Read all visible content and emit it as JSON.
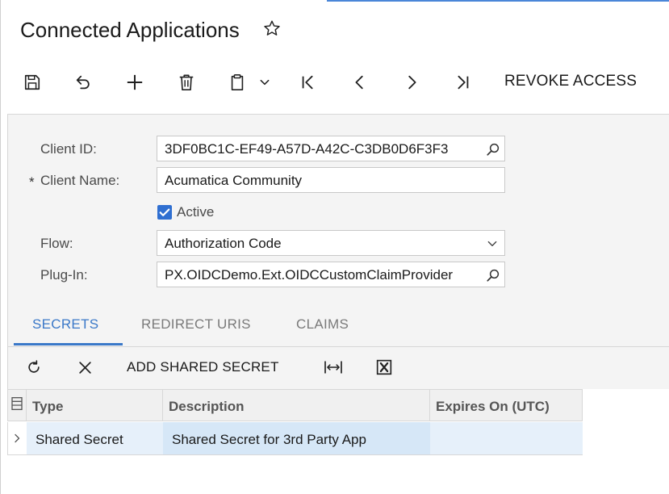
{
  "page": {
    "title": "Connected Applications"
  },
  "toolbar": {
    "buttons": [
      "save-icon",
      "undo-icon",
      "add-icon",
      "delete-icon",
      "clipboard-icon",
      "chevron-down-icon",
      "first-record-icon",
      "previous-record-icon",
      "next-record-icon",
      "last-record-icon"
    ],
    "revoke_label": "REVOKE ACCESS"
  },
  "form": {
    "client_id_label": "Client ID:",
    "client_id_value": "3DF0BC1C-EF49-A57D-A42C-C3DB0D6F3F3",
    "required_marker": "*",
    "client_name_label": "Client Name:",
    "client_name_value": "Acumatica Community",
    "active_label": "Active",
    "active_checked": true,
    "flow_label": "Flow:",
    "flow_value": "Authorization Code",
    "plugin_label": "Plug-In:",
    "plugin_value": "PX.OIDCDemo.Ext.OIDCCustomClaimProvider"
  },
  "tabs": [
    {
      "label": "SECRETS",
      "active": true
    },
    {
      "label": "REDIRECT URIS",
      "active": false
    },
    {
      "label": "CLAIMS",
      "active": false
    }
  ],
  "grid_toolbar": {
    "buttons": [
      "refresh-icon",
      "close-icon",
      "fit-columns-icon",
      "excel-icon"
    ],
    "add_label": "ADD SHARED SECRET"
  },
  "grid": {
    "columns": [
      "Type",
      "Description",
      "Expires On (UTC)"
    ],
    "rows": [
      {
        "type": "Shared Secret",
        "description": "Shared Secret for 3rd Party App",
        "expires": ""
      }
    ]
  },
  "colors": {
    "accent": "#3a78c8",
    "checkbox": "#2f6fd1",
    "row_highlight": "#e6f0fa",
    "row_selected_cell": "#d6e7f7"
  }
}
